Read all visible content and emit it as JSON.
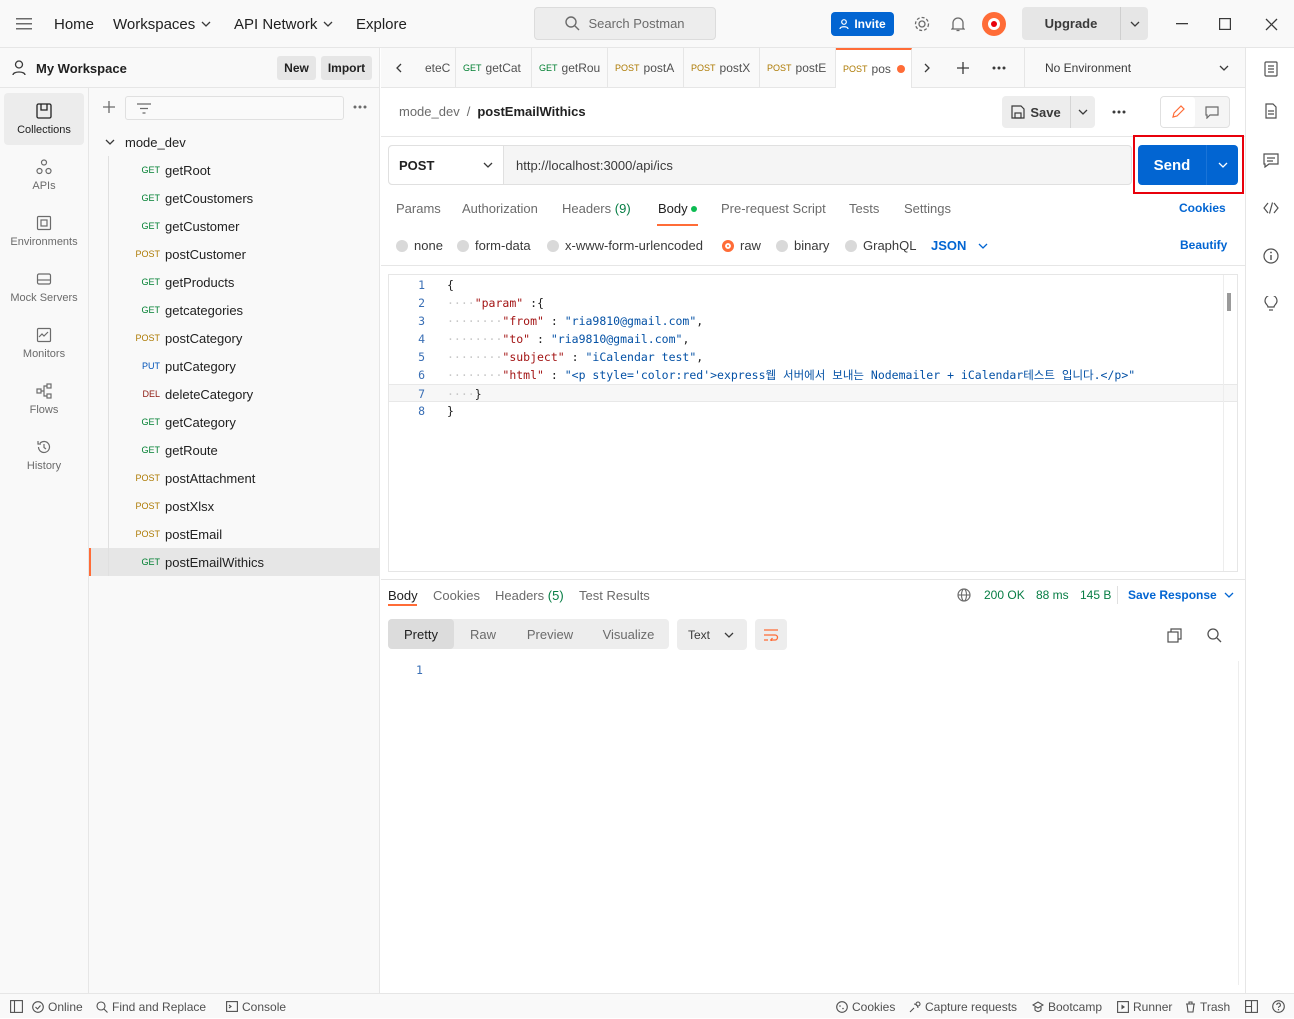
{
  "topbar": {
    "home": "Home",
    "workspaces": "Workspaces",
    "api_network": "API Network",
    "explore": "Explore",
    "search_placeholder": "Search Postman",
    "invite": "Invite",
    "upgrade": "Upgrade"
  },
  "workspace": {
    "name": "My Workspace",
    "new_label": "New",
    "import_label": "Import"
  },
  "leftnav": [
    {
      "label": "Collections",
      "icon": "collections-icon"
    },
    {
      "label": "APIs",
      "icon": "apis-icon"
    },
    {
      "label": "Environments",
      "icon": "environments-icon"
    },
    {
      "label": "Mock Servers",
      "icon": "mock-servers-icon"
    },
    {
      "label": "Monitors",
      "icon": "monitors-icon"
    },
    {
      "label": "Flows",
      "icon": "flows-icon"
    },
    {
      "label": "History",
      "icon": "history-icon"
    }
  ],
  "collection": {
    "name": "mode_dev",
    "requests": [
      {
        "method": "GET",
        "name": "getRoot"
      },
      {
        "method": "GET",
        "name": "getCoustomers"
      },
      {
        "method": "GET",
        "name": "getCustomer"
      },
      {
        "method": "POST",
        "name": "postCustomer"
      },
      {
        "method": "GET",
        "name": "getProducts"
      },
      {
        "method": "GET",
        "name": "getcategories"
      },
      {
        "method": "POST",
        "name": "postCategory"
      },
      {
        "method": "PUT",
        "name": "putCategory"
      },
      {
        "method": "DEL",
        "name": "deleteCategory"
      },
      {
        "method": "GET",
        "name": "getCategory"
      },
      {
        "method": "GET",
        "name": "getRoute"
      },
      {
        "method": "POST",
        "name": "postAttachment"
      },
      {
        "method": "POST",
        "name": "postXlsx"
      },
      {
        "method": "POST",
        "name": "postEmail"
      },
      {
        "method": "GET",
        "name": "postEmailWithics"
      }
    ]
  },
  "tabs": [
    {
      "method": "",
      "name": "eteC"
    },
    {
      "method": "GET",
      "name": "getCat"
    },
    {
      "method": "GET",
      "name": "getRou"
    },
    {
      "method": "POST",
      "name": "postA"
    },
    {
      "method": "POST",
      "name": "postX"
    },
    {
      "method": "POST",
      "name": "postE"
    },
    {
      "method": "POST",
      "name": "pos"
    }
  ],
  "environment": "No Environment",
  "request": {
    "breadcrumb_parent": "mode_dev",
    "breadcrumb_sep": "/",
    "breadcrumb_name": "postEmailWithics",
    "save_label": "Save",
    "method": "POST",
    "url": "http://localhost:3000/api/ics",
    "send_label": "Send",
    "tabs": {
      "params": "Params",
      "authorization": "Authorization",
      "headers": "Headers",
      "headers_count": "(9)",
      "body": "Body",
      "prerequest": "Pre-request Script",
      "tests": "Tests",
      "settings": "Settings",
      "cookies": "Cookies"
    },
    "body_types": [
      "none",
      "form-data",
      "x-www-form-urlencoded",
      "raw",
      "binary",
      "GraphQL"
    ],
    "format": "JSON",
    "beautify": "Beautify",
    "code": [
      {
        "n": "1",
        "indent": "",
        "html": "{"
      },
      {
        "n": "2",
        "indent": "····",
        "key": "\"param\"",
        "rest": " :{"
      },
      {
        "n": "3",
        "indent": "········",
        "key": "\"from\"",
        "rest": " : ",
        "val": "\"ria9810@gmail.com\"",
        "end": ","
      },
      {
        "n": "4",
        "indent": "········",
        "key": "\"to\"",
        "rest": " : ",
        "val": "\"ria9810@gmail.com\"",
        "end": ","
      },
      {
        "n": "5",
        "indent": "········",
        "key": "\"subject\"",
        "rest": " : ",
        "val": "\"iCalendar test\"",
        "end": ","
      },
      {
        "n": "6",
        "indent": "········",
        "key": "\"html\"",
        "rest": " : ",
        "val": "\"<p style='color:red'>express웹 서버에서 보내는 Nodemailer + iCalendar테스트 입니다.</p>\"",
        "end": ""
      },
      {
        "n": "7",
        "indent": "····",
        "html": "}"
      },
      {
        "n": "8",
        "indent": "",
        "html": "}"
      }
    ]
  },
  "response": {
    "tabs": {
      "body": "Body",
      "cookies": "Cookies",
      "headers": "Headers",
      "headers_count": "(5)",
      "test_results": "Test Results"
    },
    "status": "200 OK",
    "time": "88 ms",
    "size": "145 B",
    "save_response": "Save Response",
    "views": [
      "Pretty",
      "Raw",
      "Preview",
      "Visualize"
    ],
    "text_format": "Text",
    "line1": "1"
  },
  "bottombar": {
    "online": "Online",
    "find_replace": "Find and Replace",
    "console": "Console",
    "cookies": "Cookies",
    "capture": "Capture requests",
    "bootcamp": "Bootcamp",
    "runner": "Runner",
    "trash": "Trash"
  },
  "colors": {
    "get": "#007f31",
    "post": "#ad7a03",
    "put": "#0053b8",
    "del": "#8e1a10",
    "accent": "#ff6c37",
    "blue": "#0265d2"
  }
}
